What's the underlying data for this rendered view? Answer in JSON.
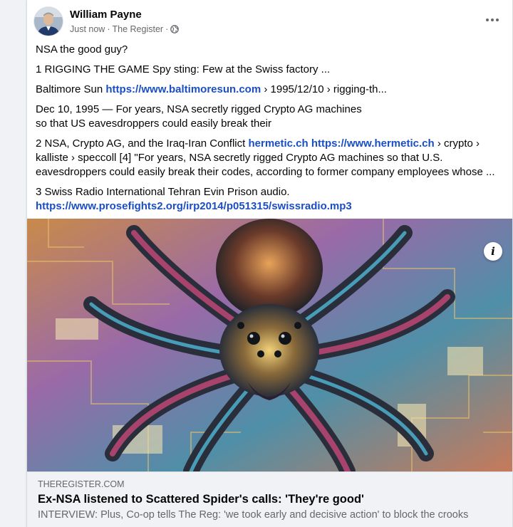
{
  "post": {
    "author": "William Payne",
    "time": "Just now",
    "source": "The Register",
    "separator": "·",
    "privacy_icon": "globe-icon",
    "more_icon": "more-options-icon"
  },
  "text": {
    "p1": "NSA the good guy?",
    "p2": "1 RIGGING THE GAME Spy sting: Few at the Swiss factory ...",
    "p3_prefix": "Baltimore Sun ",
    "p3_link": "https://www.baltimoresun.com",
    "p3_suffix": " › 1995/12/10 › rigging-th...",
    "p4_line1": "Dec 10, 1995 — For years, NSA secretly rigged Crypto AG machines",
    "p4_line2": "so that US eavesdroppers could easily break their",
    "p5_prefix": "2 NSA, Crypto AG, and the Iraq-Iran Conflict ",
    "p5_link1": "hermetic.ch",
    "p5_space": " ",
    "p5_link2": "https://www.hermetic.ch",
    "p5_suffix": " › crypto › kalliste › speccoll [4] \"For years, NSA secretly rigged Crypto AG machines so that U.S. eavesdroppers could easily break their codes, according to former company employees whose ...",
    "p6_text": "3 Swiss Radio International Tehran Evin Prison audio.",
    "p6_link": "https://www.prosefights2.org/irp2014/p051315/swissradio.mp3"
  },
  "link_preview": {
    "domain": "THEREGISTER.COM",
    "title": "Ex-NSA listened to Scattered Spider's calls: 'They're good'",
    "description": "INTERVIEW: Plus, Co-op tells The Reg: 'we took early and decisive action' to block the crooks",
    "info_icon": "info-icon",
    "info_label": "i"
  },
  "colors": {
    "link": "#1a4ec2",
    "secondary_text": "#65676b",
    "background": "#f0f2f5"
  }
}
